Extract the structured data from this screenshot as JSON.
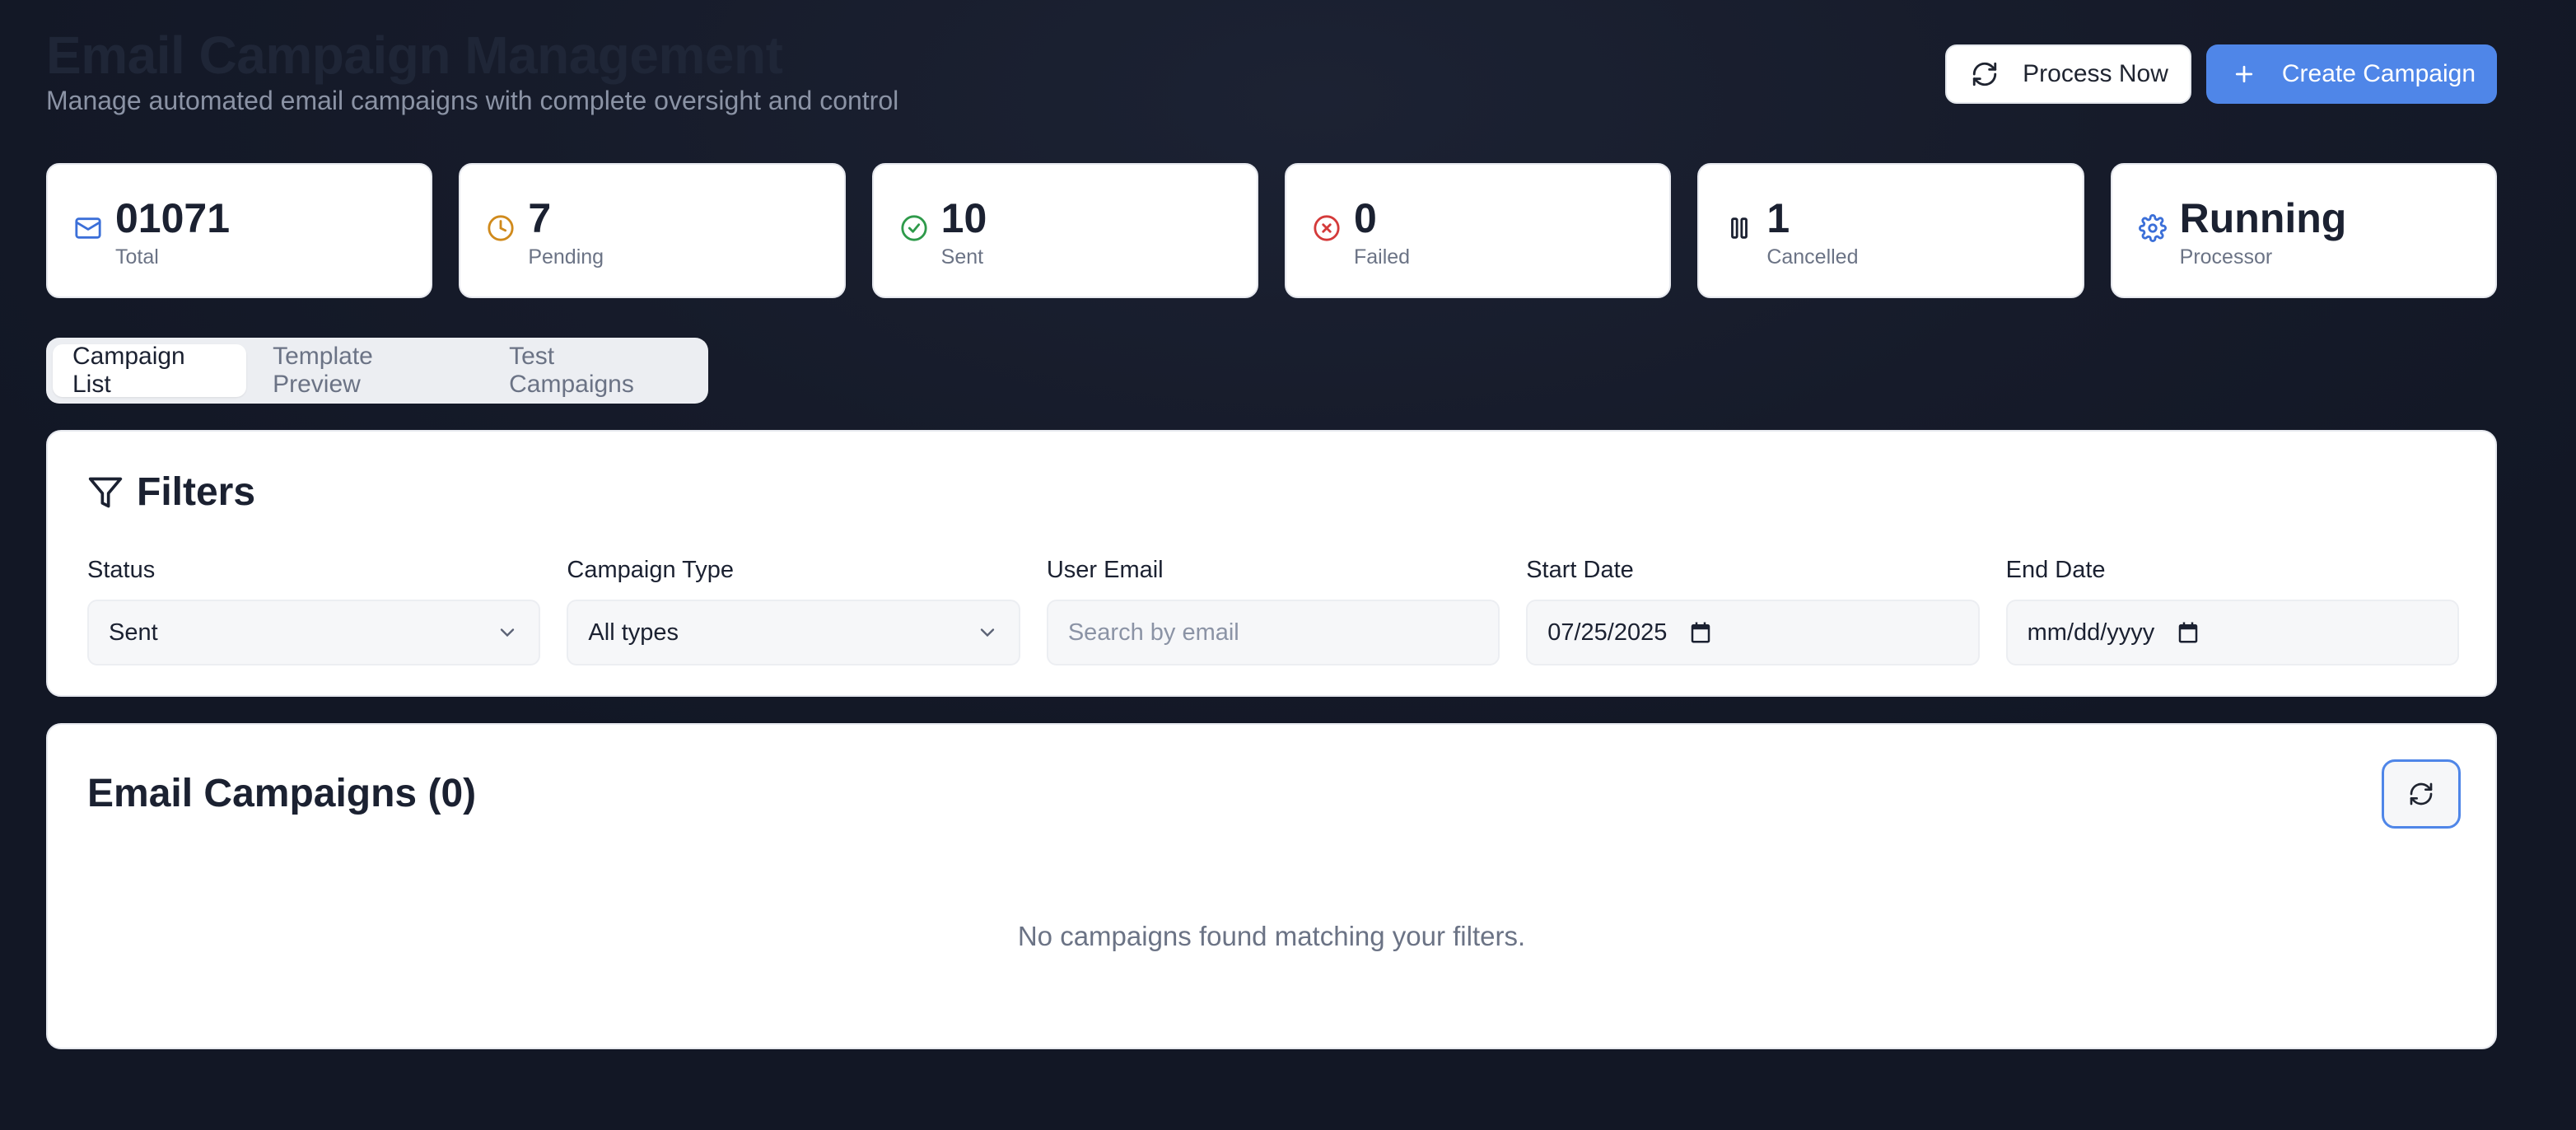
{
  "header": {
    "title": "Email Campaign Management",
    "subtitle": "Manage automated email campaigns with complete oversight and control",
    "process_now_label": "Process Now",
    "create_campaign_label": "Create Campaign"
  },
  "stats": [
    {
      "value": "01071",
      "label": "Total",
      "icon": "mail-icon",
      "color": "#3b6fd8"
    },
    {
      "value": "7",
      "label": "Pending",
      "icon": "clock-icon",
      "color": "#d08a1c"
    },
    {
      "value": "10",
      "label": "Sent",
      "icon": "check-circle-icon",
      "color": "#2e9a4a"
    },
    {
      "value": "0",
      "label": "Failed",
      "icon": "x-circle-icon",
      "color": "#d43a3a"
    },
    {
      "value": "1",
      "label": "Cancelled",
      "icon": "pause-icon",
      "color": "#1b2131"
    },
    {
      "value": "Running",
      "label": "Processor",
      "icon": "gear-icon",
      "color": "#3b6fd8"
    }
  ],
  "tabs": [
    {
      "label": "Campaign List",
      "active": true
    },
    {
      "label": "Template Preview",
      "active": false
    },
    {
      "label": "Test Campaigns",
      "active": false
    }
  ],
  "filters": {
    "title": "Filters",
    "status": {
      "label": "Status",
      "value": "Sent"
    },
    "campaign_type": {
      "label": "Campaign Type",
      "value": "All types"
    },
    "user_email": {
      "label": "User Email",
      "placeholder": "Search by email"
    },
    "start_date": {
      "label": "Start Date",
      "value": "07/25/2025"
    },
    "end_date": {
      "label": "End Date",
      "placeholder": "mm/dd/yyyy"
    }
  },
  "campaigns": {
    "title": "Email Campaigns (0)",
    "empty_message": "No campaigns found matching your filters."
  }
}
